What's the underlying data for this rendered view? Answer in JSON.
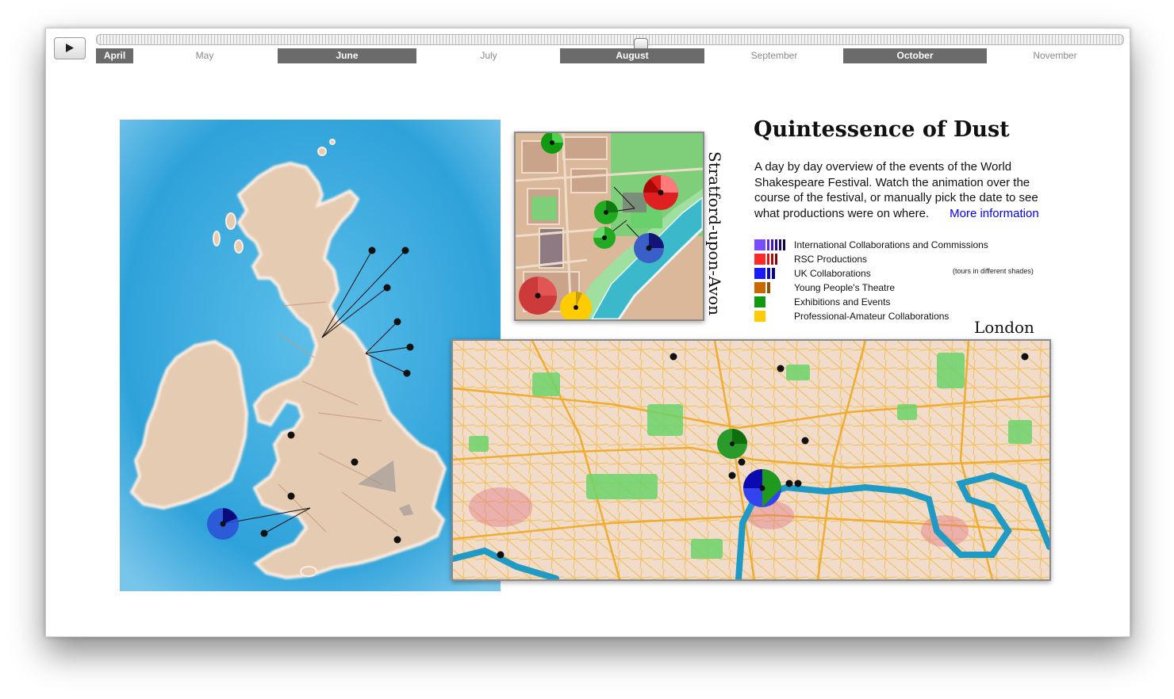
{
  "controls": {
    "play_icon": "play-icon",
    "slider_value": 0.48
  },
  "months": [
    {
      "label": "April",
      "highlighted": true
    },
    {
      "label": "May",
      "highlighted": false
    },
    {
      "label": "June",
      "highlighted": true
    },
    {
      "label": "July",
      "highlighted": false
    },
    {
      "label": "August",
      "highlighted": true
    },
    {
      "label": "September",
      "highlighted": false
    },
    {
      "label": "October",
      "highlighted": true
    },
    {
      "label": "November",
      "highlighted": false
    }
  ],
  "info": {
    "title": "Quintessence of Dust",
    "description": "A day by day overview of the events of the World Shakespeare Festival. Watch the animation over the course of the festival, or manually pick the date to see what productions were on where.",
    "more_link": "More information"
  },
  "legend": {
    "items": [
      {
        "label": "International Collaborations and Commissions",
        "colors": [
          "#7a4cff",
          "#5a2de0",
          "#3d1ab8",
          "#2a0f8c",
          "#1c0a66",
          "#120444"
        ]
      },
      {
        "label": "RSC Productions",
        "colors": [
          "#ff2a2a",
          "#e01010",
          "#b00a0a",
          "#800606"
        ]
      },
      {
        "label": "UK Collaborations",
        "colors": [
          "#1a1aff",
          "#0a0ac0",
          "#060688"
        ]
      },
      {
        "label": "Young People's Theatre",
        "colors": [
          "#cc6600",
          "#994d00"
        ]
      },
      {
        "label": "Exhibitions and Events",
        "colors": [
          "#119911"
        ]
      },
      {
        "label": "Professional-Amateur Collaborations",
        "colors": [
          "#ffcc00"
        ]
      }
    ],
    "note": "(tours in different shades)"
  },
  "maps": {
    "uk_label": "",
    "stratford_label": "Stratford-upon-Avon",
    "london_label": "London"
  },
  "colors": {
    "sea": "#3aa7dd",
    "land": "#e4c8b0",
    "active_month": "#6b6b6b"
  }
}
